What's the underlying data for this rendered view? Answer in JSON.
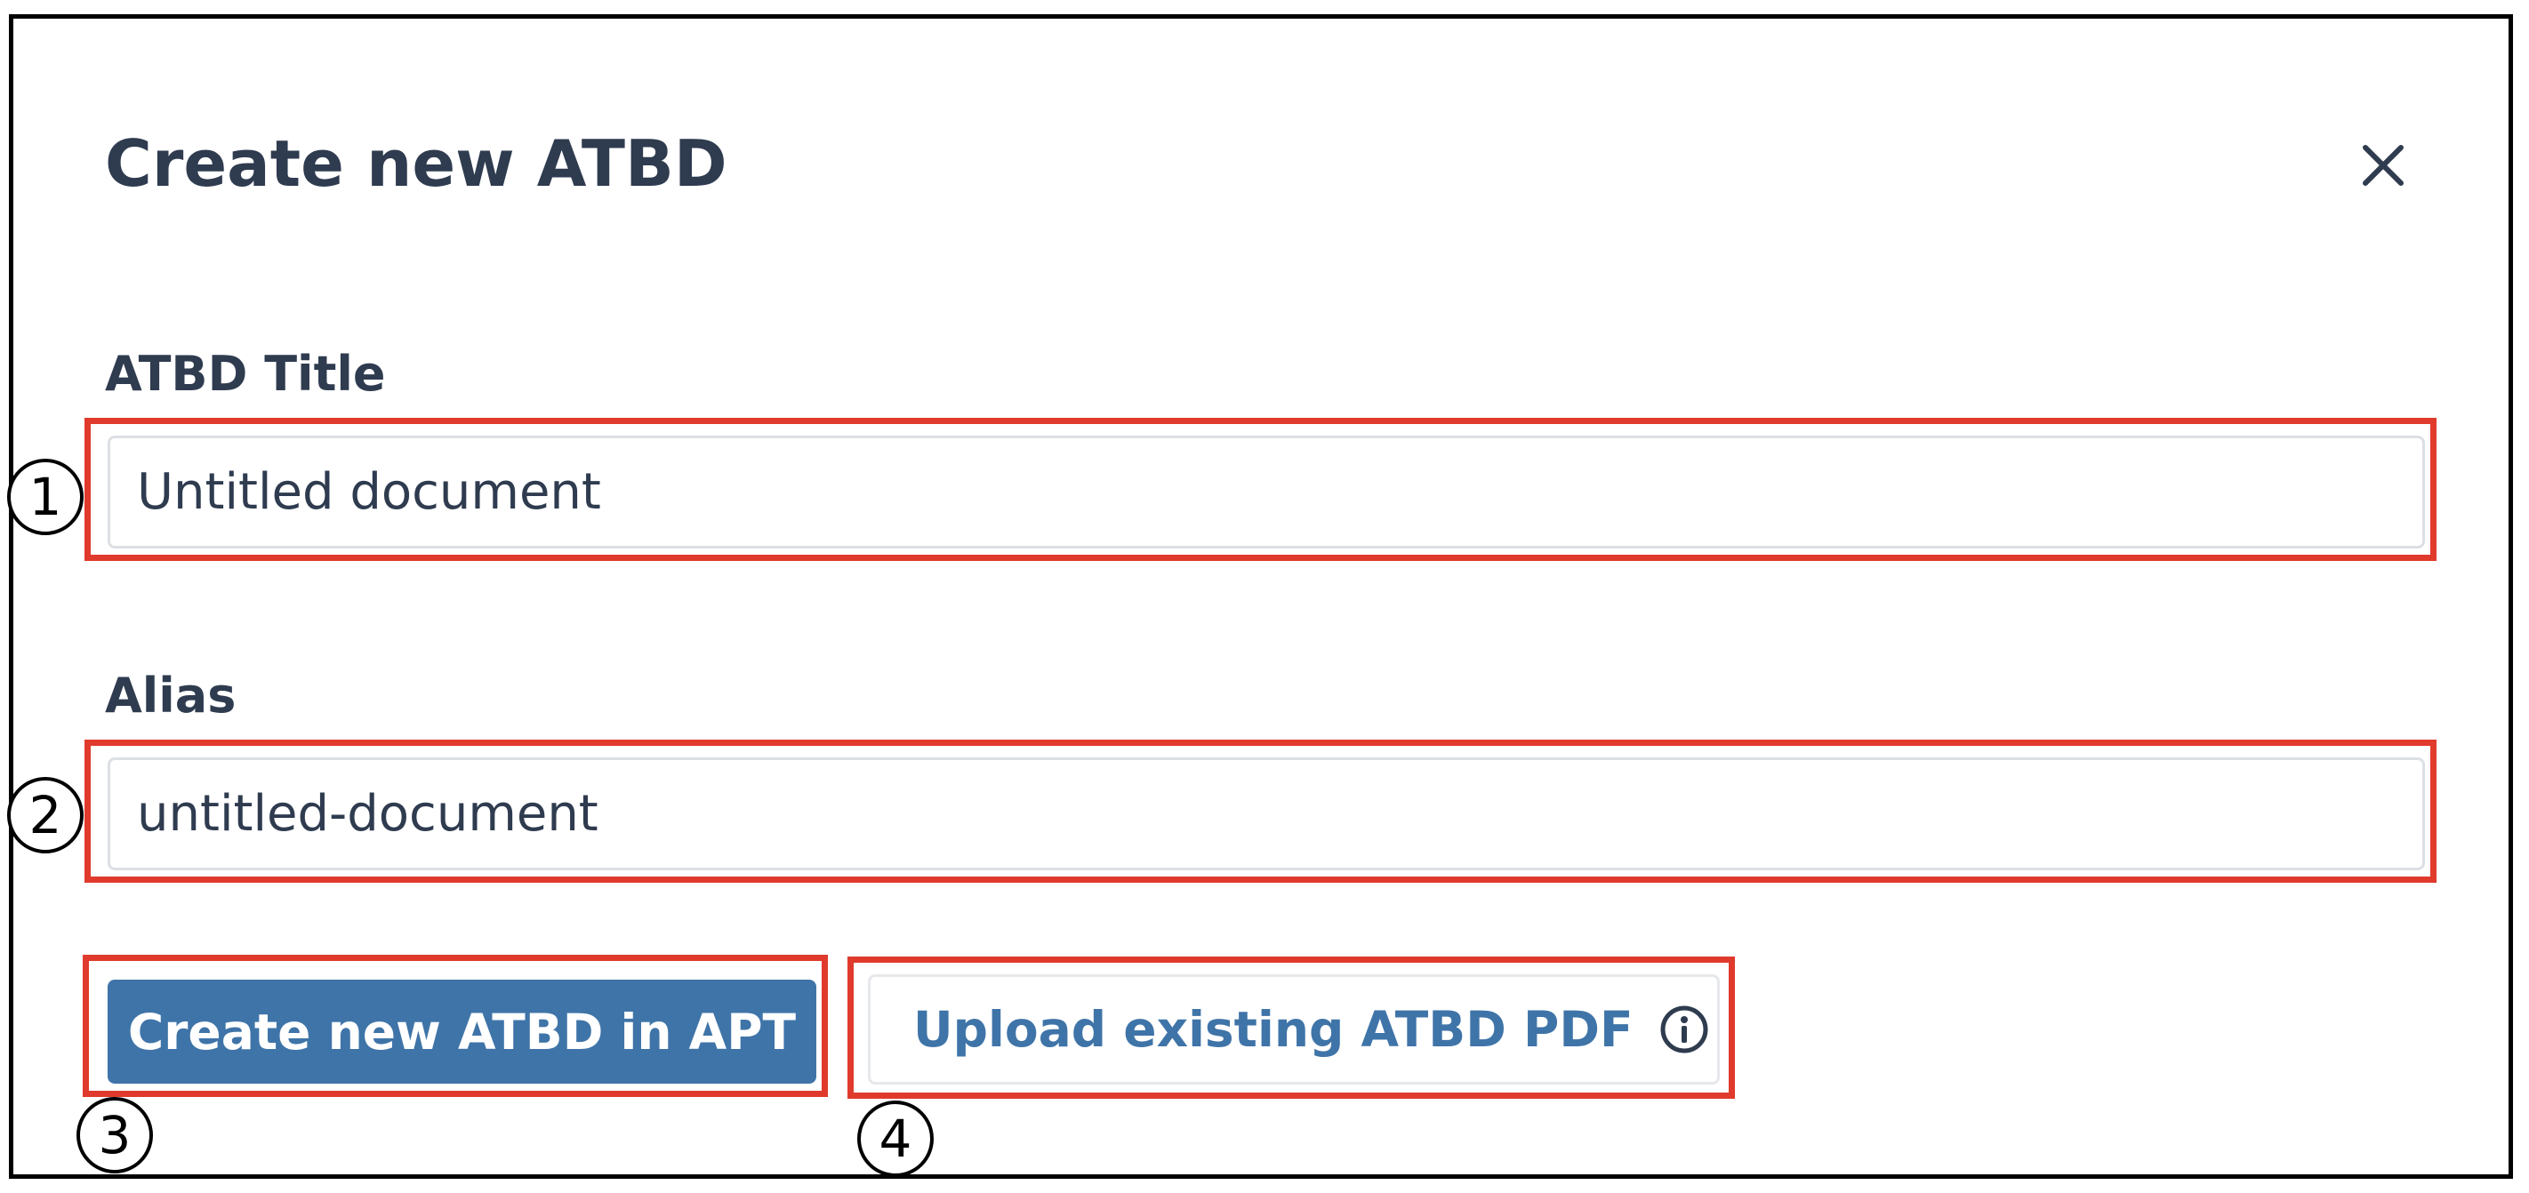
{
  "dialog": {
    "title": "Create new ATBD",
    "close_icon": "close-icon"
  },
  "fields": {
    "title": {
      "label": "ATBD Title",
      "value": "Untitled document"
    },
    "alias": {
      "label": "Alias",
      "value": "untitled-document"
    }
  },
  "actions": {
    "create_label": "Create new ATBD in APT",
    "upload_label": "Upload existing ATBD PDF",
    "upload_icon": "info-icon"
  },
  "markers": [
    "1",
    "2",
    "3",
    "4"
  ],
  "colors": {
    "primary": "#3f74a8",
    "text": "#2f3b4f",
    "highlight": "#e03a2c"
  }
}
